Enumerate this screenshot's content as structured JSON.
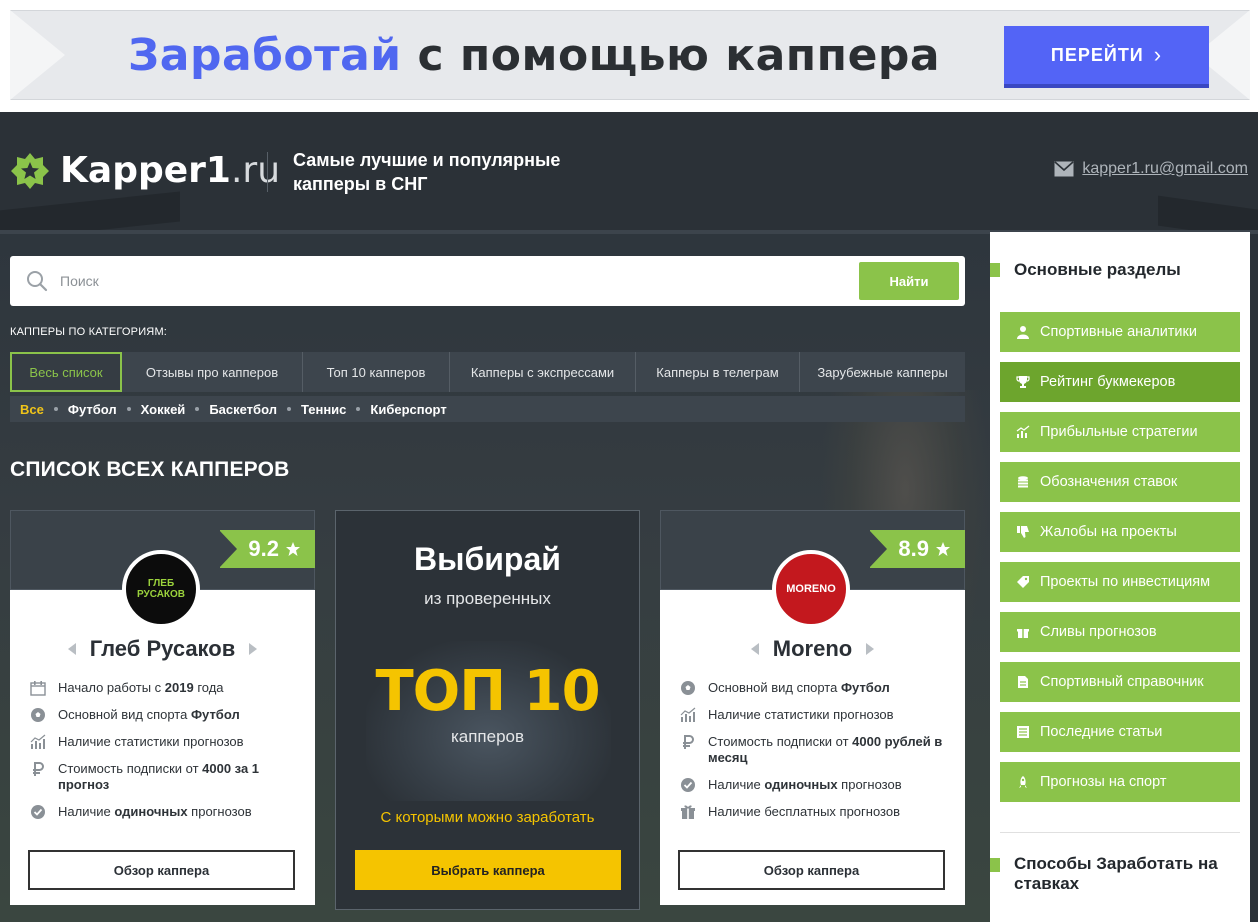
{
  "banner": {
    "text_accent": "Заработай",
    "text_rest": " с помощью каппера",
    "button_label": "ПЕРЕЙТИ"
  },
  "header": {
    "logo_name": "Kapper1",
    "logo_tld": ".ru",
    "tagline": "Самые лучшие и популярные капперы в СНГ",
    "email": "kapper1.ru@gmail.com"
  },
  "search": {
    "placeholder": "Поиск",
    "button_label": "Найти"
  },
  "categories_label": "КАППЕРЫ ПО КАТЕГОРИЯМ:",
  "tabs": [
    {
      "label": "Весь список"
    },
    {
      "label": "Отзывы про капперов"
    },
    {
      "label": "Топ 10 капперов"
    },
    {
      "label": "Капперы с экспрессами"
    },
    {
      "label": "Капперы в телеграм"
    },
    {
      "label": "Зарубежные капперы"
    }
  ],
  "sports": [
    "Все",
    "Футбол",
    "Хоккей",
    "Баскетбол",
    "Теннис",
    "Киберспорт"
  ],
  "section_title": "СПИСОК ВСЕХ КАППЕРОВ",
  "cards": [
    {
      "rating": "9.2",
      "avatar_text": "ГЛЕБ РУСАКОВ",
      "name": "Глеб Русаков",
      "features": [
        {
          "icon": "calendar-icon",
          "pre": "Начало работы с ",
          "bold": "2019",
          "post": " года"
        },
        {
          "icon": "soccer-ball-icon",
          "pre": "Основной вид спорта ",
          "bold": "Футбол",
          "post": ""
        },
        {
          "icon": "stats-icon",
          "pre": "Наличие статистики прогнозов",
          "bold": "",
          "post": ""
        },
        {
          "icon": "ruble-icon",
          "pre": "Стоимость подписки от ",
          "bold": "4000 за 1 прогноз",
          "post": ""
        },
        {
          "icon": "check-circle-icon",
          "pre": "Наличие ",
          "bold": "одиночных",
          "post": " прогнозов"
        }
      ],
      "button_label": "Обзор каппера"
    },
    {
      "rating": "8.9",
      "avatar_text": "MORENO",
      "name": "Moreno",
      "features": [
        {
          "icon": "soccer-ball-icon",
          "pre": "Основной вид спорта ",
          "bold": "Футбол",
          "post": ""
        },
        {
          "icon": "stats-icon",
          "pre": "Наличие статистики прогнозов",
          "bold": "",
          "post": ""
        },
        {
          "icon": "ruble-icon",
          "pre": "Стоимость подписки от ",
          "bold": "4000 рублей в месяц",
          "post": ""
        },
        {
          "icon": "check-circle-icon",
          "pre": "Наличие ",
          "bold": "одиночных",
          "post": " прогнозов"
        },
        {
          "icon": "gift-icon",
          "pre": "Наличие бесплатных прогнозов",
          "bold": "",
          "post": ""
        }
      ],
      "button_label": "Обзор каппера"
    }
  ],
  "promo": {
    "title": "Выбирай",
    "subtitle": "из проверенных",
    "top": "ТОП 10",
    "kappers": "капперов",
    "earn": "С которыми можно заработать",
    "button_label": "Выбрать каппера"
  },
  "sidebar": {
    "title": "Основные разделы",
    "items": [
      {
        "label": "Спортивные аналитики",
        "icon": "user-icon"
      },
      {
        "label": "Рейтинг букмекеров",
        "icon": "trophy-icon"
      },
      {
        "label": "Прибыльные стратегии",
        "icon": "chart-icon"
      },
      {
        "label": "Обозначения ставок",
        "icon": "coins-icon"
      },
      {
        "label": "Жалобы на проекты",
        "icon": "thumbs-down-icon"
      },
      {
        "label": "Проекты по инвестициям",
        "icon": "tag-icon"
      },
      {
        "label": "Сливы прогнозов",
        "icon": "gift-icon"
      },
      {
        "label": "Спортивный справочник",
        "icon": "document-icon"
      },
      {
        "label": "Последние статьи",
        "icon": "list-icon"
      },
      {
        "label": "Прогнозы на спорт",
        "icon": "rocket-icon"
      }
    ],
    "title2": "Способы Заработать на ставках"
  },
  "colors": {
    "accent_green": "#8bc34a",
    "accent_yellow": "#f5c400",
    "banner_blue": "#5364f6",
    "header_dark": "#2b3137"
  }
}
